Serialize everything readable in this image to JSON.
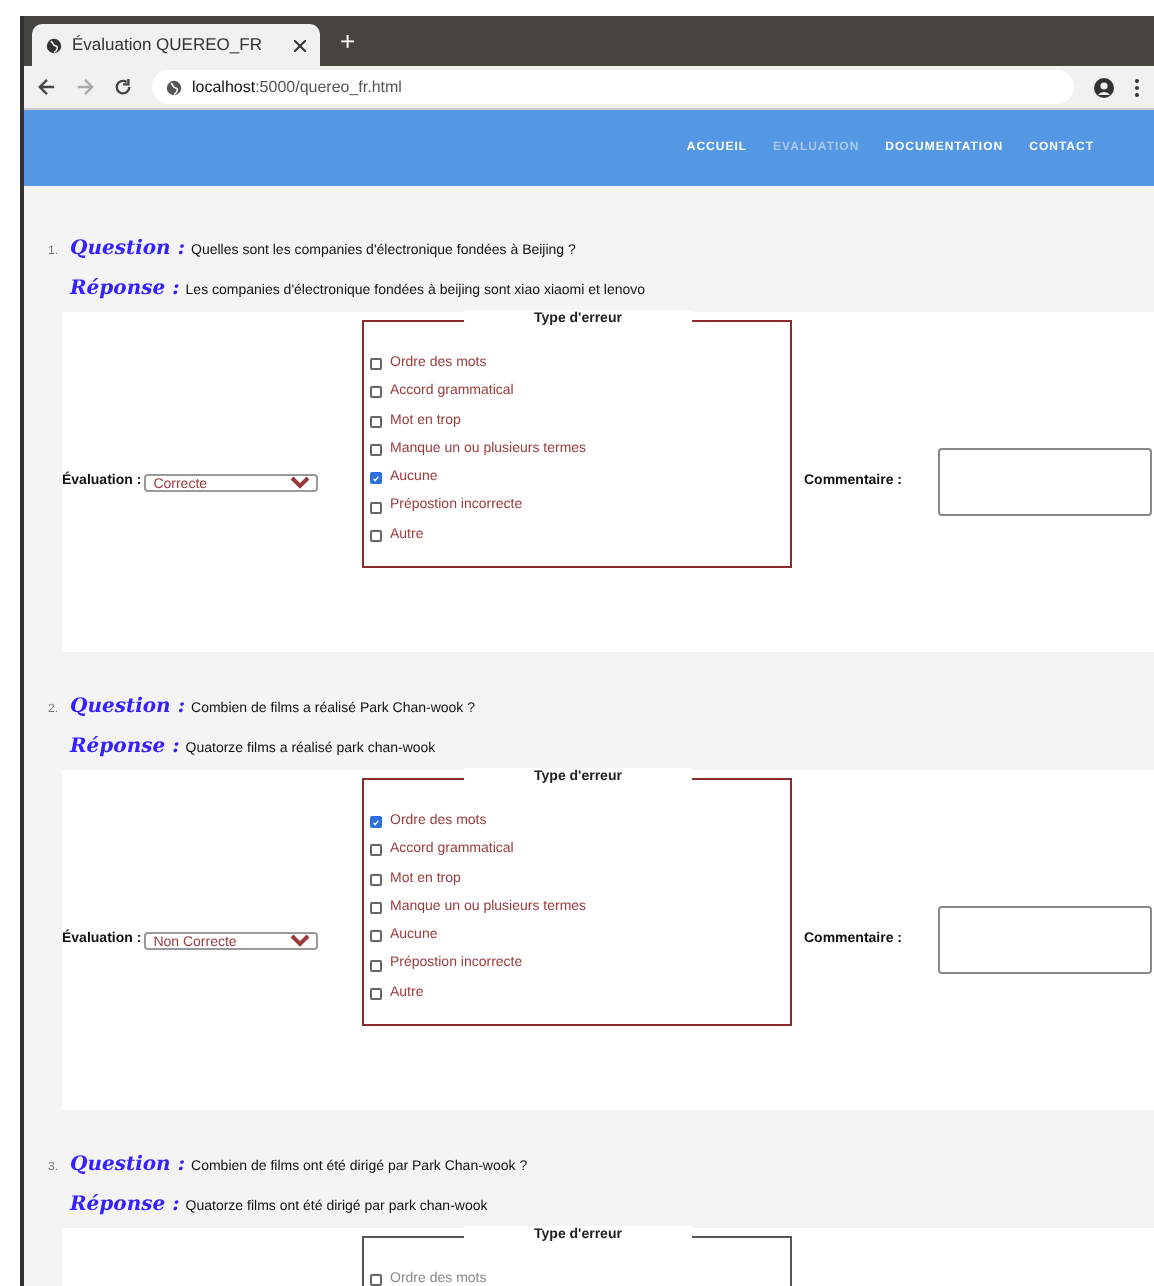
{
  "browser": {
    "tab_title": "Évaluation QUEREO_FR",
    "new_tab": "+",
    "url_host": "localhost",
    "url_path": ":5000/quereo_fr.html"
  },
  "nav": [
    {
      "label": "ACCUEIL",
      "selected": false
    },
    {
      "label": "EVALUATION",
      "selected": true
    },
    {
      "label": "DOCUMENTATION",
      "selected": false
    },
    {
      "label": "CONTACT",
      "selected": false
    }
  ],
  "questions": [
    {
      "number": "1.",
      "question_label": "Question :",
      "question": "Quelles sont les companies d'électronique fondées à Beijing ?",
      "answer_label": "Réponse :",
      "answer": "Les companies d'électronique fondées à beijing sont xiao xiaomi et lenovo",
      "evaluation_label": "Évaluation :",
      "evaluation": "Correcte",
      "error_title": "Type d'erreur",
      "error_active": true,
      "comment_label": "Commentaire :",
      "options": [
        {
          "label": "Ordre des mots",
          "checked": false
        },
        {
          "label": "Accord grammatical",
          "checked": false
        },
        {
          "label": "Mot en trop",
          "checked": false
        },
        {
          "label": "Manque un ou plusieurs termes",
          "checked": false
        },
        {
          "label": "Aucune",
          "checked": true
        },
        {
          "label": "Prépostion incorrecte",
          "checked": false
        },
        {
          "label": "Autre",
          "checked": false
        }
      ]
    },
    {
      "number": "2.",
      "question_label": "Question :",
      "question": "Combien de films a réalisé Park Chan-wook ?",
      "answer_label": "Réponse :",
      "answer": "Quatorze films a réalisé park chan-wook",
      "evaluation_label": "Évaluation :",
      "evaluation": "Non Correcte",
      "error_title": "Type d'erreur",
      "error_active": true,
      "comment_label": "Commentaire :",
      "options": [
        {
          "label": "Ordre des mots",
          "checked": true
        },
        {
          "label": "Accord grammatical",
          "checked": false
        },
        {
          "label": "Mot en trop",
          "checked": false
        },
        {
          "label": "Manque un ou plusieurs termes",
          "checked": false
        },
        {
          "label": "Aucune",
          "checked": false
        },
        {
          "label": "Prépostion incorrecte",
          "checked": false
        },
        {
          "label": "Autre",
          "checked": false
        }
      ]
    },
    {
      "number": "3.",
      "question_label": "Question :",
      "question": "Combien de films ont été dirigé par Park Chan-wook ?",
      "answer_label": "Réponse :",
      "answer": "Quatorze films ont été dirigé par park chan-wook",
      "error_title": "Type d'erreur",
      "error_active": false,
      "options": [
        {
          "label": "Ordre des mots",
          "checked": false
        }
      ]
    }
  ]
}
